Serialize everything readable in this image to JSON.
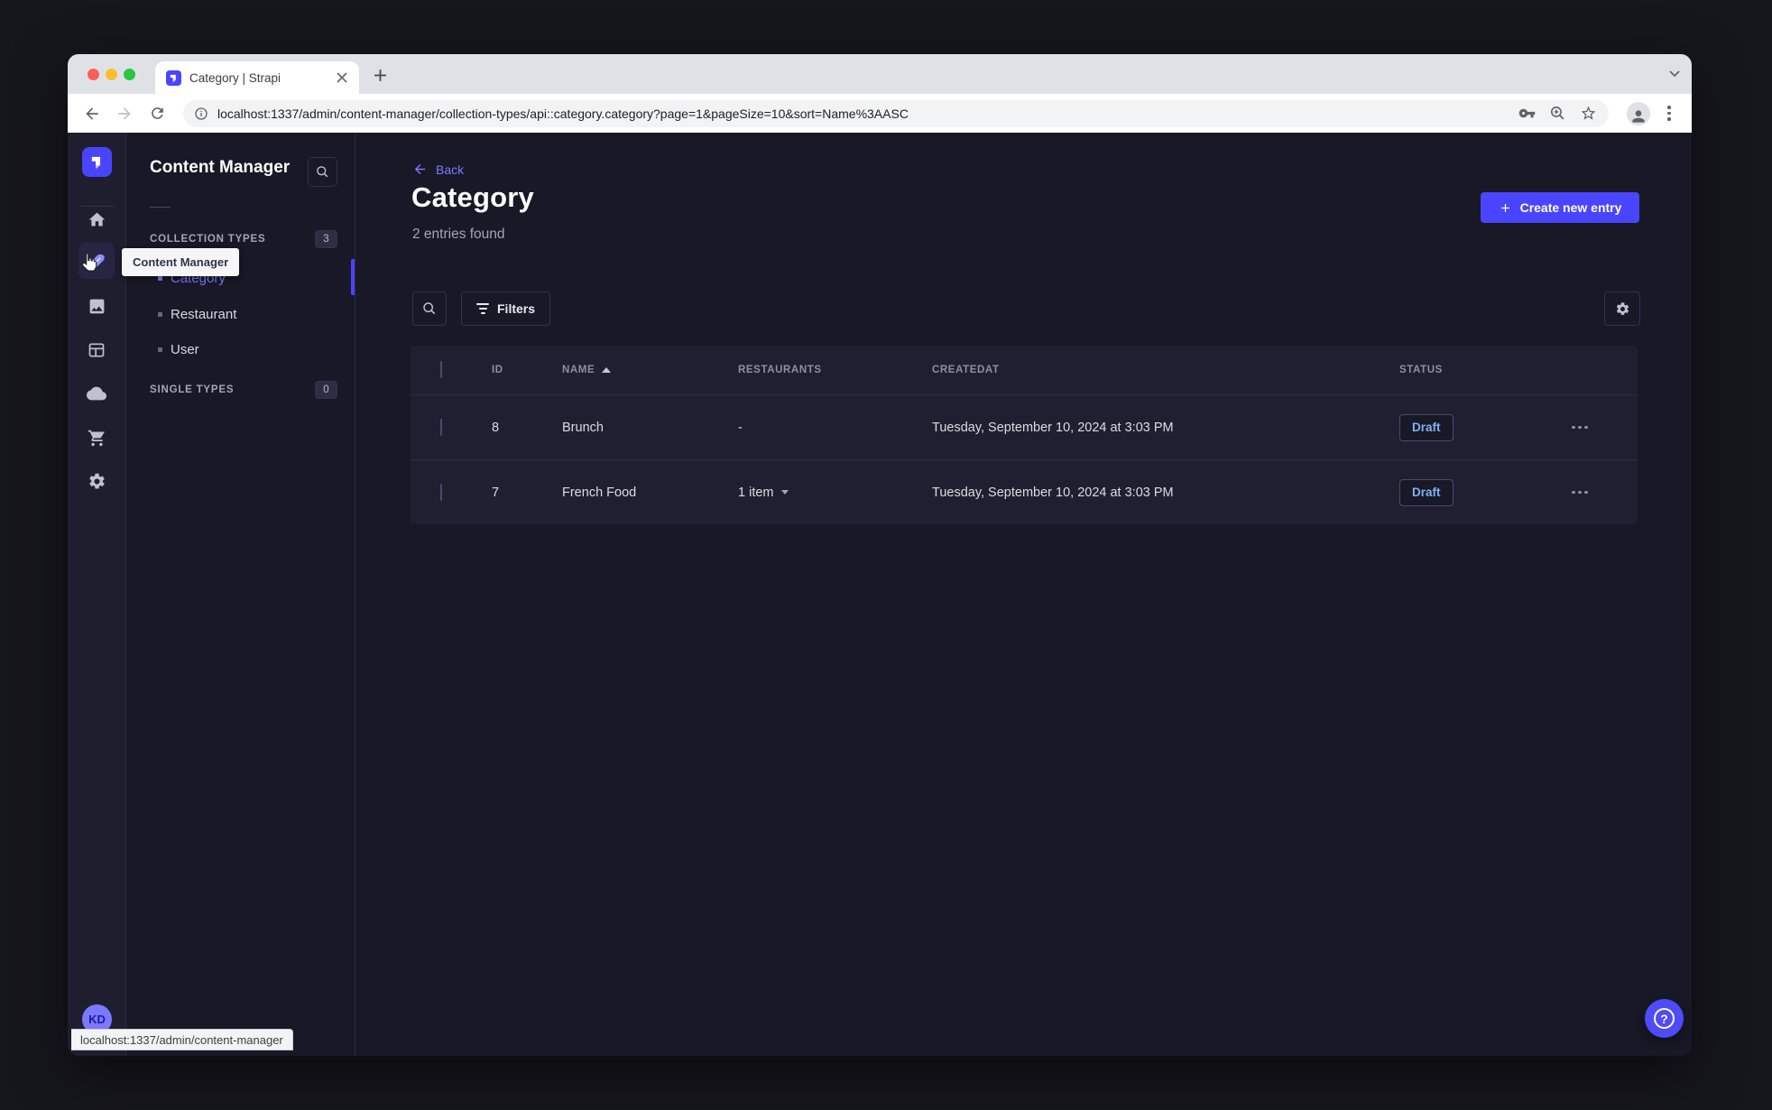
{
  "browser": {
    "tab_title": "Category | Strapi",
    "url": "localhost:1337/admin/content-manager/collection-types/api::category.category?page=1&pageSize=10&sort=Name%3AASC",
    "status_bar": "localhost:1337/admin/content-manager"
  },
  "sidebar": {
    "avatar_initials": "KD"
  },
  "subnav": {
    "title": "Content Manager",
    "groups": [
      {
        "label": "COLLECTION TYPES",
        "count": "3",
        "items": [
          {
            "label": "Category"
          },
          {
            "label": "Restaurant"
          },
          {
            "label": "User"
          }
        ]
      },
      {
        "label": "SINGLE TYPES",
        "count": "0",
        "items": []
      }
    ]
  },
  "tooltip": {
    "text": "Content Manager"
  },
  "page": {
    "back_label": "Back",
    "title": "Category",
    "subtitle": "2 entries found",
    "create_button": "Create new entry",
    "filters_button": "Filters"
  },
  "table": {
    "columns": [
      "ID",
      "NAME",
      "RESTAURANTS",
      "CREATEDAT",
      "STATUS"
    ],
    "rows": [
      {
        "id": "8",
        "name": "Brunch",
        "restaurants": "-",
        "has_relation_toggle": false,
        "created_at": "Tuesday, September 10, 2024 at 3:03 PM",
        "status": "Draft"
      },
      {
        "id": "7",
        "name": "French Food",
        "restaurants": "1 item",
        "has_relation_toggle": true,
        "created_at": "Tuesday, September 10, 2024 at 3:03 PM",
        "status": "Draft"
      }
    ]
  },
  "help_fab": {
    "glyph": "?"
  },
  "colors": {
    "accent": "#4945ff",
    "link": "#7b79ff",
    "draft_text": "#7cb2f6"
  }
}
